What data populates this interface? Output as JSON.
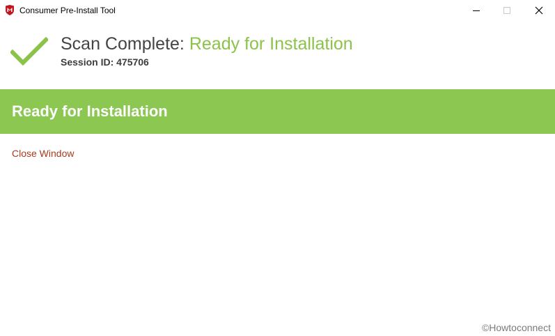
{
  "window": {
    "title": "Consumer Pre-Install Tool",
    "icon": "mcafee-shield-icon"
  },
  "header": {
    "scan_label": "Scan Complete: ",
    "scan_status": "Ready for Installation",
    "session_label": "Session ID: 475706"
  },
  "banner": {
    "text": "Ready for Installation"
  },
  "actions": {
    "close_window": "Close Window"
  },
  "watermark": "©Howtoconnect",
  "colors": {
    "accent_green": "#8bc751",
    "status_green": "#8bc34a",
    "link_red": "#a83a1c",
    "brand_red": "#c0161d"
  }
}
